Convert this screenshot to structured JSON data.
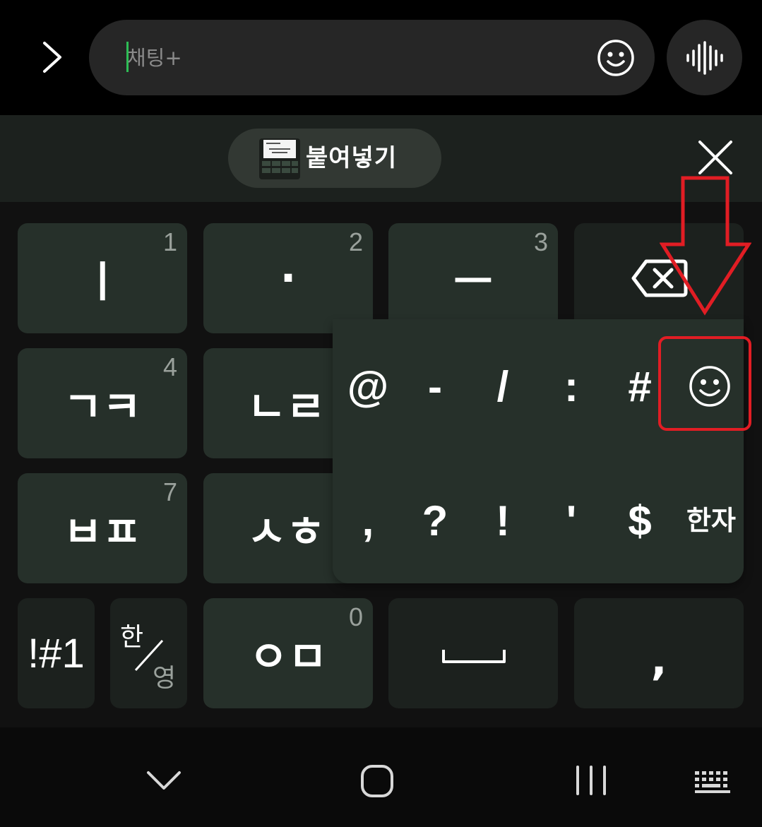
{
  "input_bar": {
    "placeholder": "채팅+",
    "expand_icon": "chevron-right-icon",
    "emoji_icon": "smiley-icon",
    "voice_icon": "voice-waveform-icon"
  },
  "clipboard": {
    "paste_label": "붙여넣기",
    "close_icon": "close-icon"
  },
  "keyboard": {
    "row1": [
      {
        "main": "ㅣ",
        "hint": "1"
      },
      {
        "main": "·",
        "hint": "2"
      },
      {
        "main": "ㅡ",
        "hint": "3"
      }
    ],
    "row2": [
      {
        "main": "ㄱㅋ",
        "hint": "4"
      },
      {
        "main": "ㄴㄹ",
        "hint": ""
      }
    ],
    "row3": [
      {
        "main": "ㅂㅍ",
        "hint": "7"
      },
      {
        "main": "ㅅㅎ",
        "hint": ""
      }
    ],
    "row4": {
      "symbols": "!#1",
      "lang_top": "한",
      "lang_bottom": "영",
      "zero_key": "ㅇㅁ",
      "zero_hint": "0",
      "comma": ","
    }
  },
  "popup": {
    "row1": [
      "@",
      "-",
      "/",
      ":",
      "#"
    ],
    "row2": [
      ",",
      "?",
      "!",
      "'",
      "$"
    ],
    "hanja": "한자",
    "emoji_icon": "smiley-icon"
  },
  "colors": {
    "key_bg": "#26302a",
    "annotation_red": "#e11d24",
    "caret_green": "#2dbd55"
  },
  "nav": {
    "back_icon": "chevron-down-icon",
    "home_icon": "home-icon",
    "recents_icon": "recents-icon",
    "keyboard_icon": "keyboard-icon"
  }
}
